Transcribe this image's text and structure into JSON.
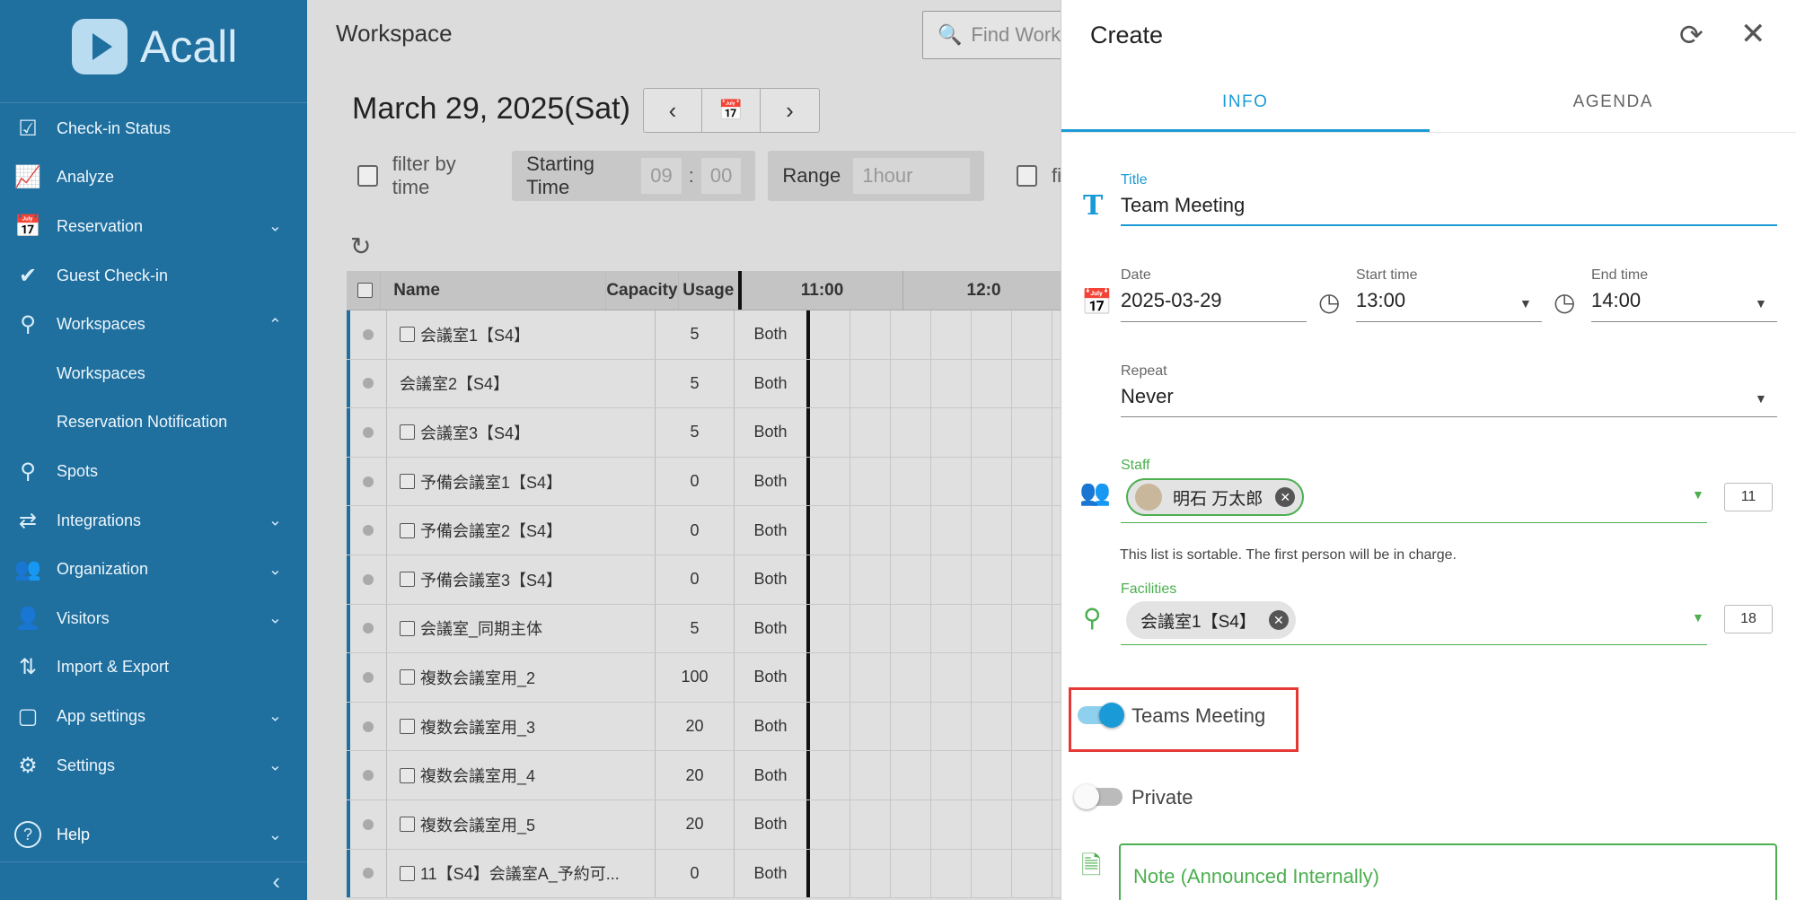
{
  "sidebar": {
    "brand": "Acall",
    "items": [
      {
        "label": "Check-in Status",
        "icon": "checkbox-icon"
      },
      {
        "label": "Analyze",
        "icon": "chart-line-icon"
      },
      {
        "label": "Reservation",
        "icon": "calendar-clock-icon",
        "chevron": "down"
      },
      {
        "label": "Guest Check-in",
        "icon": "checkmark-icon"
      },
      {
        "label": "Workspaces",
        "icon": "location-pin-icon",
        "chevron": "up"
      },
      {
        "label": "Workspaces",
        "sub": true
      },
      {
        "label": "Reservation Notification",
        "sub": true
      },
      {
        "label": "Spots",
        "icon": "spot-pin-icon"
      },
      {
        "label": "Integrations",
        "icon": "integrations-icon",
        "chevron": "down"
      },
      {
        "label": "Organization",
        "icon": "group-icon",
        "chevron": "down"
      },
      {
        "label": "Visitors",
        "icon": "visitor-icon",
        "chevron": "down"
      },
      {
        "label": "Import & Export",
        "icon": "import-export-icon"
      },
      {
        "label": "App settings",
        "icon": "app-window-icon",
        "chevron": "down"
      },
      {
        "label": "Settings",
        "icon": "gears-icon",
        "chevron": "down"
      }
    ],
    "help": "Help"
  },
  "main": {
    "title": "Workspace",
    "search_placeholder": "Find Work",
    "date": "March 29, 2025(Sat)",
    "filter_by_time": "filter by time",
    "starting_time_label": "Starting Time",
    "start_hour": "09",
    "start_sep": ":",
    "start_min": "00",
    "range_label": "Range",
    "range_value": "1hour",
    "filter_more": "fi",
    "columns": [
      "Name",
      "Capacity",
      "Usage"
    ],
    "time_headers": [
      "11:00",
      "12:0"
    ],
    "rows": [
      {
        "name": "会議室1【S4】",
        "capacity": "5",
        "usage": "Both",
        "cb": true
      },
      {
        "name": "会議室2【S4】",
        "capacity": "5",
        "usage": "Both",
        "cb": false
      },
      {
        "name": "会議室3【S4】",
        "capacity": "5",
        "usage": "Both",
        "cb": true
      },
      {
        "name": "予備会議室1【S4】",
        "capacity": "0",
        "usage": "Both",
        "cb": true
      },
      {
        "name": "予備会議室2【S4】",
        "capacity": "0",
        "usage": "Both",
        "cb": true
      },
      {
        "name": "予備会議室3【S4】",
        "capacity": "0",
        "usage": "Both",
        "cb": true
      },
      {
        "name": "会議室_同期主体",
        "capacity": "5",
        "usage": "Both",
        "cb": true
      },
      {
        "name": "複数会議室用_2",
        "capacity": "100",
        "usage": "Both",
        "cb": true
      },
      {
        "name": "複数会議室用_3",
        "capacity": "20",
        "usage": "Both",
        "cb": true
      },
      {
        "name": "複数会議室用_4",
        "capacity": "20",
        "usage": "Both",
        "cb": true
      },
      {
        "name": "複数会議室用_5",
        "capacity": "20",
        "usage": "Both",
        "cb": true
      },
      {
        "name": "11【S4】会議室A_予約可...",
        "capacity": "0",
        "usage": "Both",
        "cb": true
      }
    ]
  },
  "panel": {
    "title": "Create",
    "tabs": [
      "INFO",
      "AGENDA"
    ],
    "title_label": "Title",
    "title_value": "Team Meeting",
    "date_label": "Date",
    "date_value": "2025-03-29",
    "start_label": "Start time",
    "start_value": "13:00",
    "end_label": "End time",
    "end_value": "14:00",
    "repeat_label": "Repeat",
    "repeat_value": "Never",
    "staff_label": "Staff",
    "staff_chip": "明石 万太郎",
    "staff_count": "11",
    "staff_hint": "This list is sortable. The first person will be in charge.",
    "facilities_label": "Facilities",
    "facility_chip": "会議室1【S4】",
    "facility_count": "18",
    "teams_label": "Teams Meeting",
    "teams_on": true,
    "private_label": "Private",
    "private_on": false,
    "note_placeholder": "Note (Announced Internally)",
    "colors": {
      "accent": "#1a9bd7",
      "green": "#4caf50",
      "highlight": "#e53935"
    }
  }
}
